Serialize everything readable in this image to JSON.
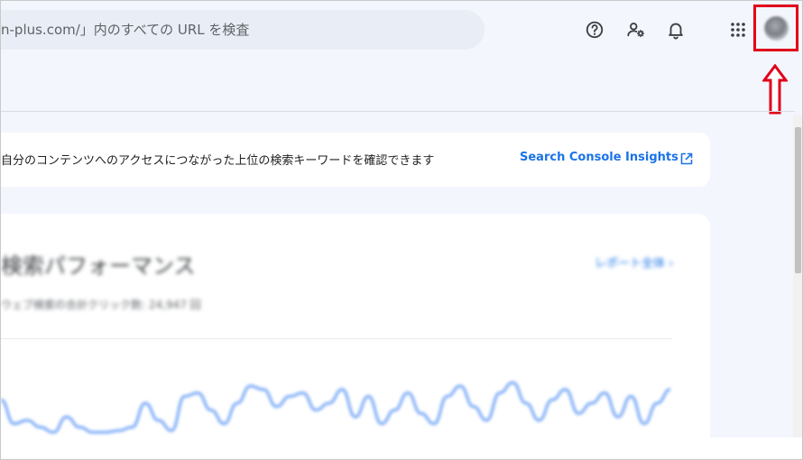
{
  "search": {
    "placeholder": "n-plus.com/」内のすべての URL を検査"
  },
  "header": {
    "icons": [
      "help-circle-icon",
      "manage-users-icon",
      "notifications-bell-icon",
      "apps-grid-icon"
    ],
    "annotation_color": "#e0001b"
  },
  "insights": {
    "text": "自分のコンテンツへのアクセスにつながった上位の検索キーワードを確認できます",
    "link_label": "Search Console Insights",
    "link_color": "#1a73e8"
  },
  "performance": {
    "title": "検索パフォーマンス",
    "report_link": "レポート全体 ›",
    "subtitle": "ウェブ検索の合計クリック数: 24,947 回"
  },
  "chart_data": {
    "type": "line",
    "series": [
      {
        "values": [
          22,
          8,
          10,
          6,
          3,
          12,
          6,
          3,
          3,
          4,
          6,
          20,
          10,
          4,
          24,
          26,
          16,
          8,
          20,
          30,
          28,
          18,
          24,
          26,
          16,
          20,
          28,
          12,
          24,
          8,
          16,
          26,
          14,
          8,
          24,
          30,
          18,
          10,
          26,
          32,
          20,
          10,
          22,
          28,
          14,
          20,
          26,
          12,
          24,
          8,
          20,
          28
        ]
      }
    ],
    "color": "#8ab4f8",
    "ylim": [
      0,
      40
    ]
  }
}
